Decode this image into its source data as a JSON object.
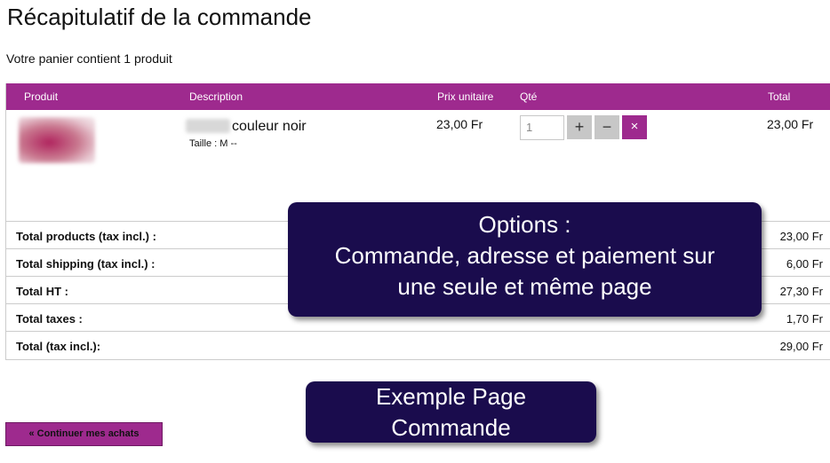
{
  "page": {
    "title": "Récapitulatif de la commande",
    "cart_count": "Votre panier contient 1 produit"
  },
  "table": {
    "headers": [
      "Produit",
      "Description",
      "Prix unitaire",
      "Qté",
      "Total"
    ],
    "item": {
      "name": "couleur noir",
      "attributes": "Taille : M --",
      "unit_price": "23,00 Fr",
      "quantity": "1",
      "plus": "+",
      "minus": "−",
      "delete": "×",
      "total": "23,00 Fr"
    },
    "totals": [
      {
        "label": "Total products (tax incl.) :",
        "value": "23,00 Fr"
      },
      {
        "label": "Total shipping (tax incl.) :",
        "value": "6,00 Fr"
      },
      {
        "label": "Total HT :",
        "value": "27,30 Fr"
      },
      {
        "label": "Total taxes :",
        "value": "1,70 Fr"
      },
      {
        "label": "Total (tax incl.):",
        "value": "29,00 Fr"
      }
    ]
  },
  "continue_button": "« Continuer mes achats",
  "callouts": {
    "options_line1": "Options :",
    "options_line2": "Commande, adresse et paiement sur",
    "options_line3": "une seule et même page",
    "example_line1": "Exemple Page",
    "example_line2": "Commande"
  },
  "colors": {
    "accent": "#9e2a8e",
    "callout_bg": "#1a0c4d"
  }
}
